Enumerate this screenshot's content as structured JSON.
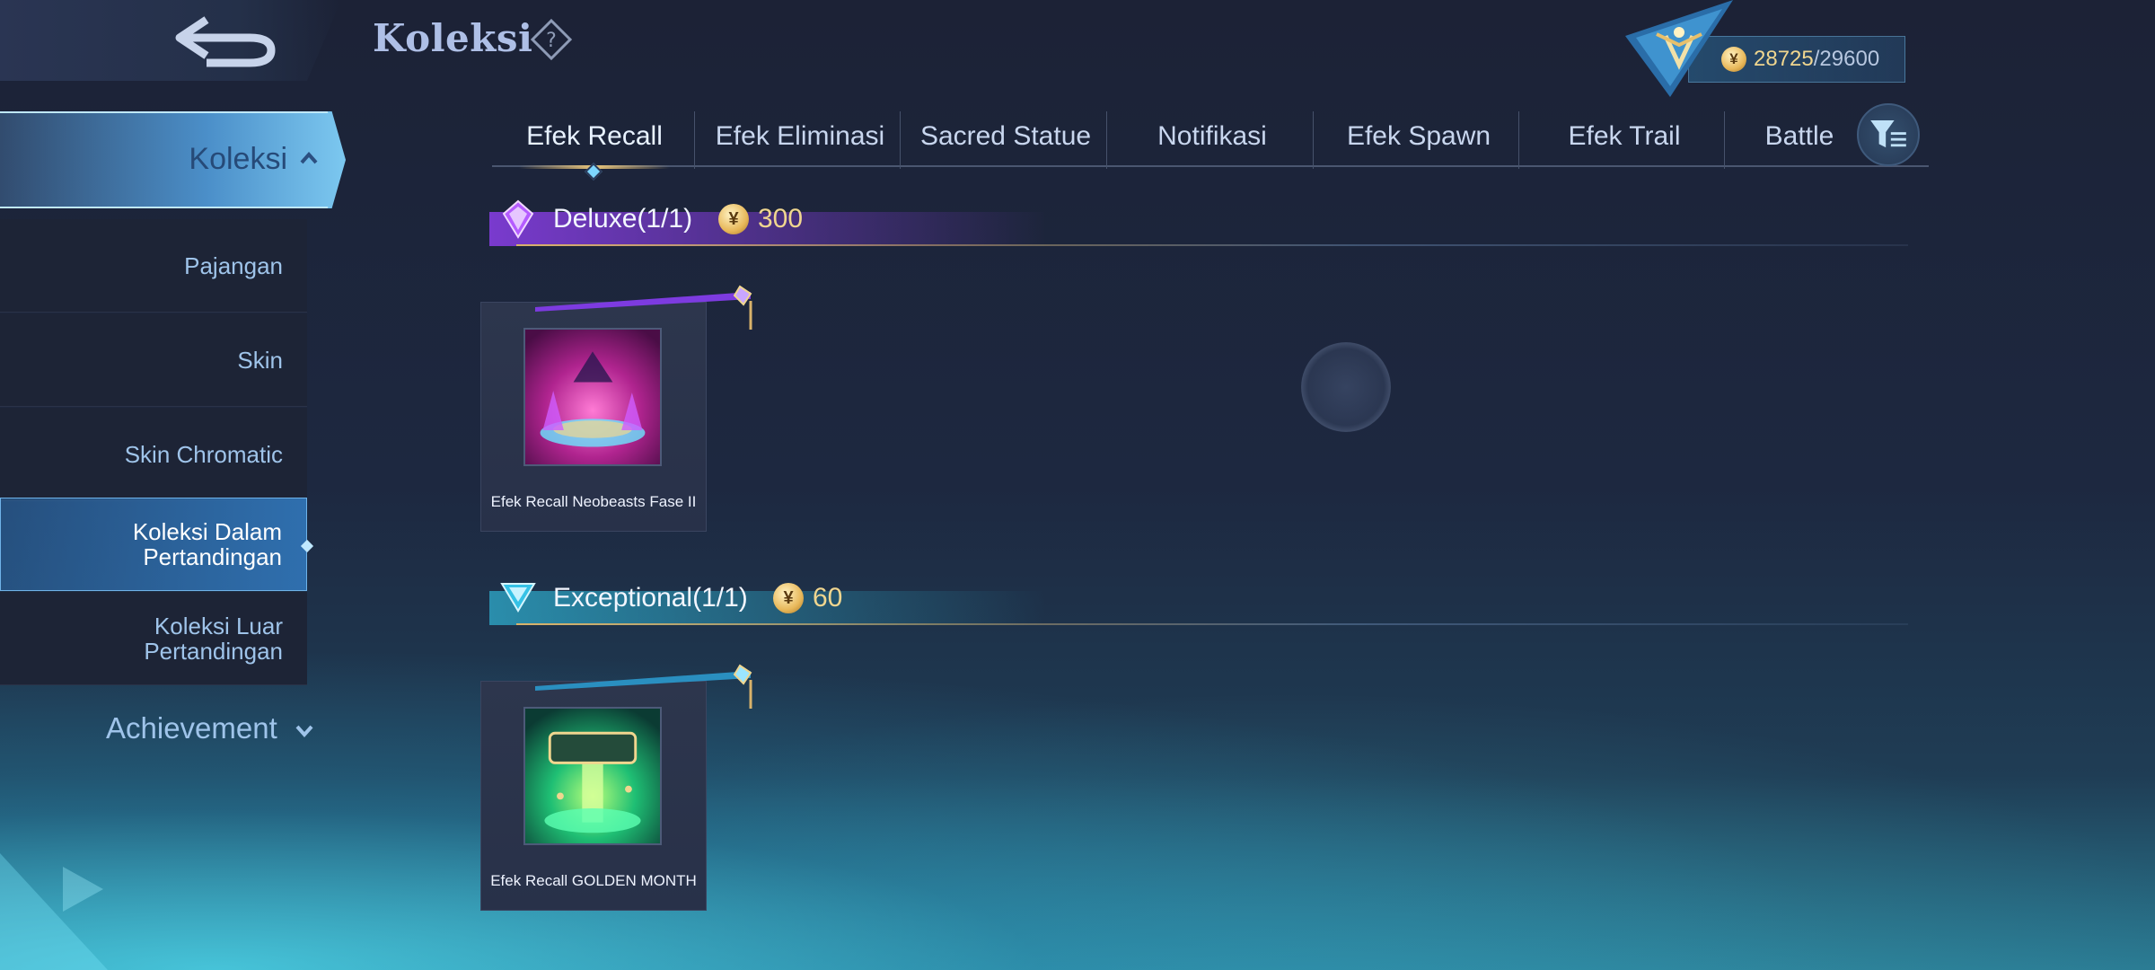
{
  "header": {
    "title": "Koleksi",
    "currency": {
      "current": "28725",
      "separator": "/",
      "max": "29600"
    }
  },
  "sidebar": {
    "header": "Koleksi",
    "items": [
      {
        "label": "Pajangan"
      },
      {
        "label": "Skin"
      },
      {
        "label": "Skin Chromatic"
      },
      {
        "label": "Koleksi Dalam\nPertandingan",
        "active": true
      },
      {
        "label": "Koleksi Luar\nPertandingan"
      }
    ],
    "achievement": "Achievement"
  },
  "tabs": [
    {
      "label": "Efek Recall",
      "active": true
    },
    {
      "label": "Efek Eliminasi"
    },
    {
      "label": "Sacred Statue"
    },
    {
      "label": "Notifikasi"
    },
    {
      "label": "Efek Spawn"
    },
    {
      "label": "Efek Trail"
    },
    {
      "label": "Battle"
    }
  ],
  "sections": [
    {
      "name": "Deluxe",
      "count": "(1/1)",
      "points": "300",
      "color": "#8a3ee8",
      "items": [
        {
          "caption": "Efek Recall Neobeasts Fase II"
        }
      ]
    },
    {
      "name": "Exceptional",
      "count": "(1/1)",
      "points": "60",
      "color": "#2fb5d6",
      "items": [
        {
          "caption": "Efek Recall GOLDEN MONTH"
        }
      ]
    }
  ],
  "colors": {
    "accent": "#7cc8f0",
    "gold": "#f0d68f",
    "sidebar_active": "#2f6fae"
  },
  "icons": {
    "back": "back-arrow-icon",
    "help": "question-diamond-icon",
    "filter": "filter-icon",
    "coin": "coin-icon"
  }
}
